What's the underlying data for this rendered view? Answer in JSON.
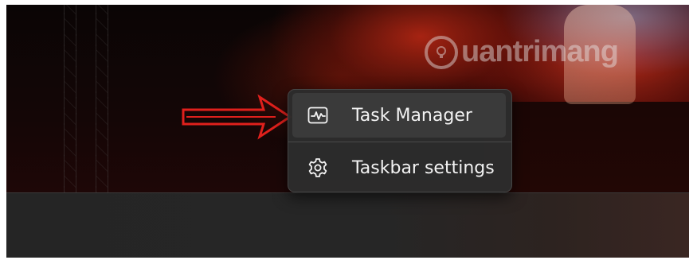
{
  "watermark": {
    "text": "uantrimang"
  },
  "context_menu": {
    "items": [
      {
        "label": "Task Manager",
        "icon": "task-manager-icon",
        "hovered": true
      },
      {
        "label": "Taskbar settings",
        "icon": "gear-icon",
        "hovered": false
      }
    ]
  },
  "colors": {
    "arrow": "#e0201c",
    "menu_bg": "#2c2c2c",
    "menu_text": "#f3f3f3",
    "taskbar": "#252525"
  }
}
